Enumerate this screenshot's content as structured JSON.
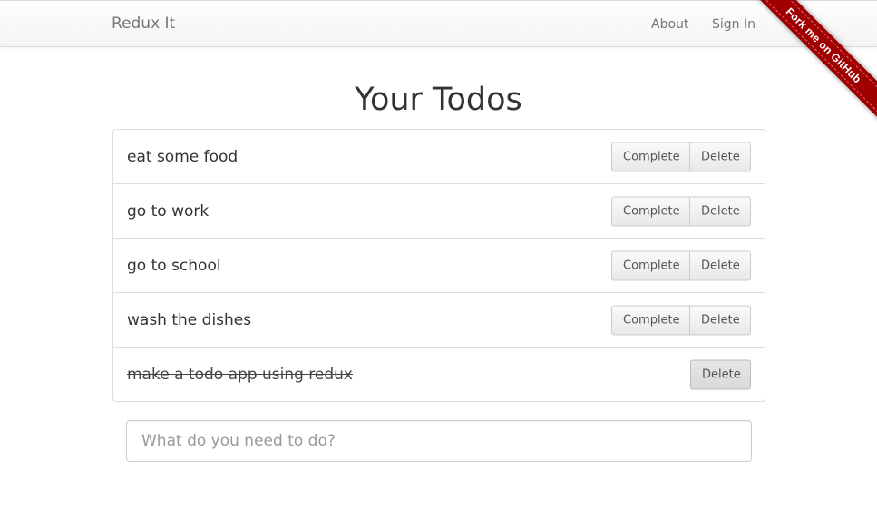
{
  "navbar": {
    "brand": "Redux It",
    "links": [
      "About",
      "Sign In"
    ]
  },
  "ribbon": {
    "label": "Fork me on GitHub",
    "color": "#a00000"
  },
  "page": {
    "title": "Your Todos"
  },
  "todos": [
    {
      "text": "eat some food",
      "completed": false,
      "complete_label": "Complete",
      "delete_label": "Delete"
    },
    {
      "text": "go to work",
      "completed": false,
      "complete_label": "Complete",
      "delete_label": "Delete"
    },
    {
      "text": "go to school",
      "completed": false,
      "complete_label": "Complete",
      "delete_label": "Delete"
    },
    {
      "text": "wash the dishes",
      "completed": false,
      "complete_label": "Complete",
      "delete_label": "Delete"
    },
    {
      "text": "make a todo app using redux",
      "completed": true,
      "delete_label": "Delete"
    }
  ],
  "new_todo": {
    "value": "",
    "placeholder": "What do you need to do?"
  }
}
